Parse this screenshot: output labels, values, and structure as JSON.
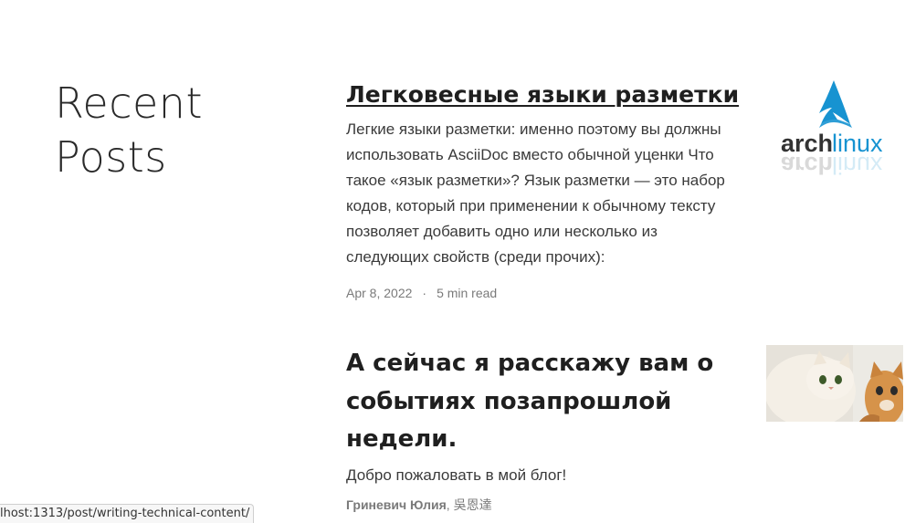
{
  "section": {
    "title": "Recent Posts"
  },
  "posts": [
    {
      "title": "Легковесные языки разметки",
      "summary": "Легкие языки разметки: именно поэтому вы должны использовать AsciiDoc вместо обычной уценки Что такое «язык разметки»? Язык разметки — это набор кодов, который при применении к обычному тексту позволяет добавить одно или несколько из следующих свойств (среди прочих):",
      "date": "Apr 8, 2022",
      "separator": "·",
      "read_time": "5 min read",
      "thumbnail": {
        "name": "archlinux-logo",
        "text_arch": "arch",
        "text_linux": "linux",
        "color": "#1793d1"
      }
    },
    {
      "title": "А сейчас я расскажу вам о событиях позапрошлой недели.",
      "summary": "Добро пожаловать в мой блог!",
      "authors": {
        "primary": "Гриневич Юлия",
        "separator": ", ",
        "secondary": "吳恩達"
      },
      "thumbnail": {
        "name": "cats-photo"
      }
    }
  ],
  "statusbar": {
    "url": "lhost:1313/post/writing-technical-content/"
  }
}
